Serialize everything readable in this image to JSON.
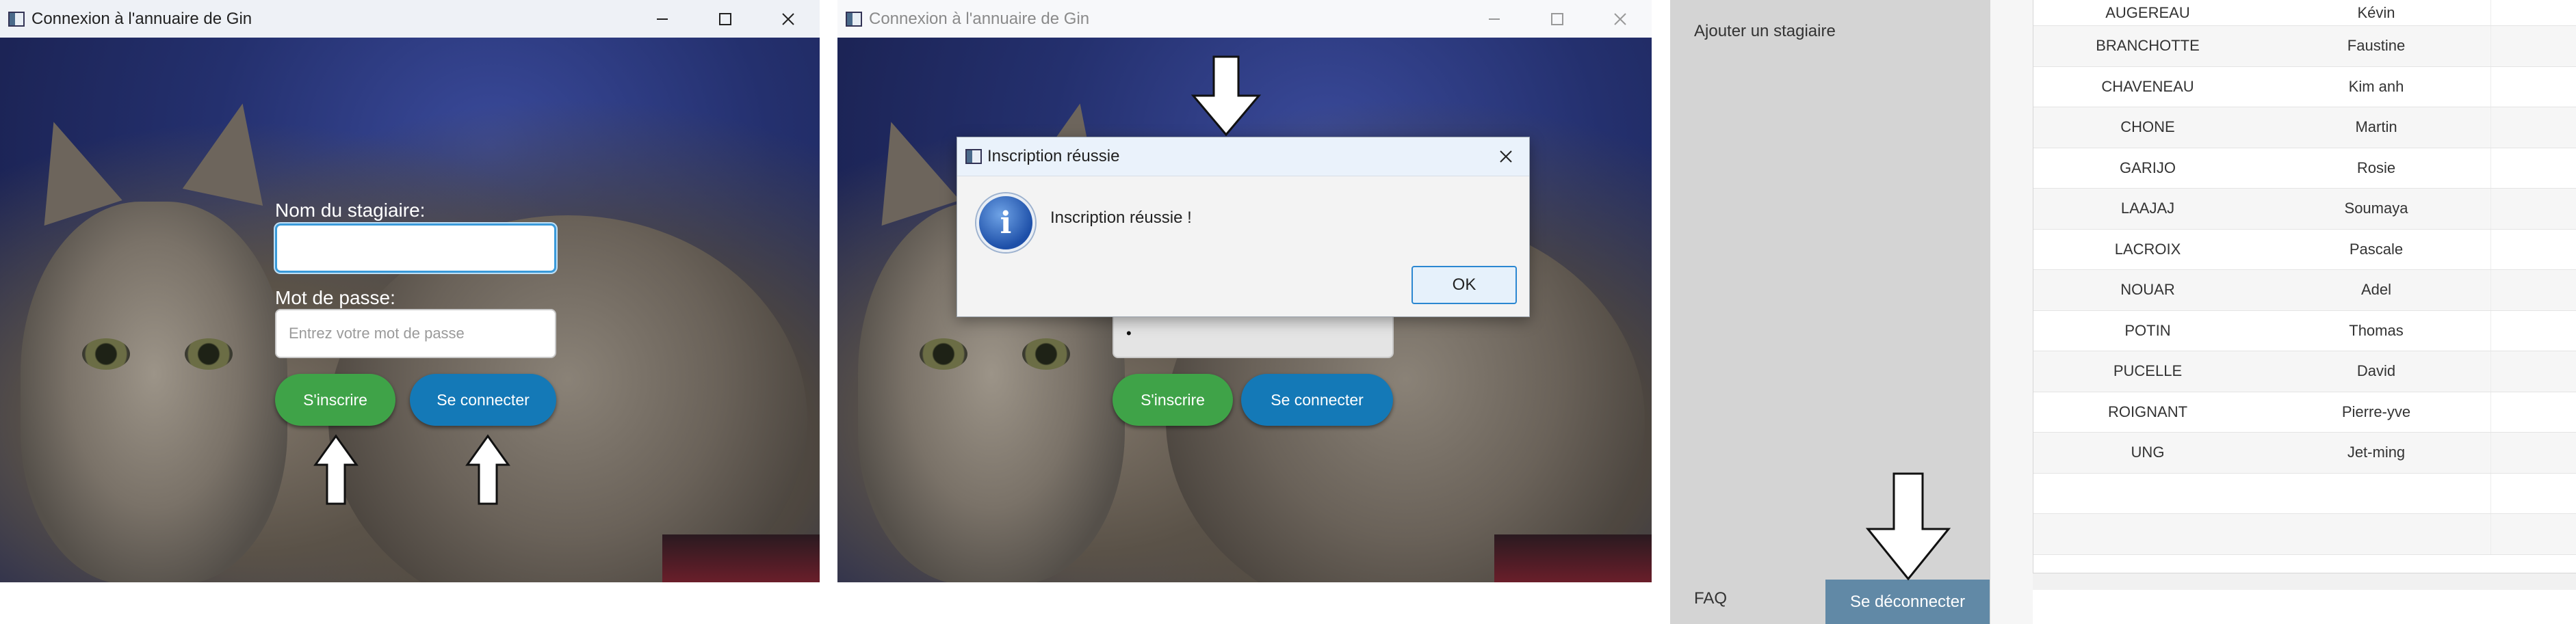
{
  "window1": {
    "title": "Connexion à l'annuaire de Gin",
    "name_label": "Nom du stagiaire:",
    "name_value": "",
    "password_label": "Mot de passe:",
    "password_placeholder": "Entrez votre mot de passe",
    "register_button": "S'inscrire",
    "login_button": "Se connecter"
  },
  "window2": {
    "title": "Connexion à l'annuaire de Gin",
    "password_value": "•",
    "register_button": "S'inscrire",
    "login_button": "Se connecter"
  },
  "dialog": {
    "title": "Inscription réussie",
    "message": "Inscription réussie !",
    "ok_button": "OK",
    "icon": "info-icon"
  },
  "panel3": {
    "sidebar": {
      "add_intern": "Ajouter un stagiaire",
      "faq": "FAQ",
      "logout_button": "Se déconnecter"
    },
    "rows": [
      {
        "last": "AUGEREAU",
        "first": "Kévin"
      },
      {
        "last": "BRANCHOTTE",
        "first": "Faustine"
      },
      {
        "last": "CHAVENEAU",
        "first": "Kim anh"
      },
      {
        "last": "CHONE",
        "first": "Martin"
      },
      {
        "last": "GARIJO",
        "first": "Rosie"
      },
      {
        "last": "LAAJAJ",
        "first": "Soumaya"
      },
      {
        "last": "LACROIX",
        "first": "Pascale"
      },
      {
        "last": "NOUAR",
        "first": "Adel"
      },
      {
        "last": "POTIN",
        "first": "Thomas"
      },
      {
        "last": "PUCELLE",
        "first": "David"
      },
      {
        "last": "ROIGNANT",
        "first": "Pierre-yve"
      },
      {
        "last": "UNG",
        "first": "Jet-ming"
      }
    ]
  },
  "colors": {
    "register_green": "#3fa348",
    "login_blue": "#1479b7",
    "logout_blue": "#6189a6",
    "sidebar_gray": "#d4d4d4"
  }
}
